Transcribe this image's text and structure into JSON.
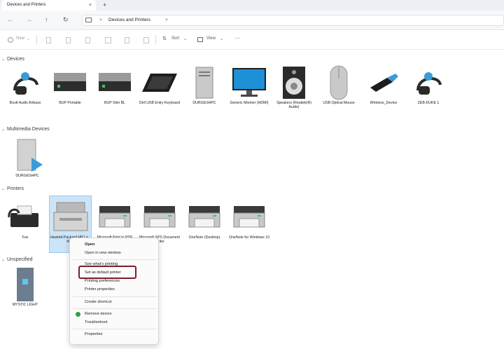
{
  "window": {
    "tab_title": "Devices and Printers",
    "close": "×",
    "new_tab": "+"
  },
  "address": {
    "back": "←",
    "forward": "→",
    "up": "↑",
    "refresh": "↻",
    "sep1": ">",
    "location": "Devices and Printers",
    "sep2": ">"
  },
  "toolbar": {
    "new": "New",
    "new_chev": "⌄",
    "sort": "Sort",
    "sort_chev": "⌄",
    "view": "View",
    "view_chev": "⌄",
    "more": "···"
  },
  "sections": {
    "devices": "Devices",
    "multimedia": "Multimedia Devices",
    "printers": "Printers",
    "unspecified": "Unspecified"
  },
  "devices": [
    {
      "label": "Boult Audio Airbass",
      "icon": "headset-icon"
    },
    {
      "label": "BUP Portable",
      "icon": "drive-icon"
    },
    {
      "label": "BUP Slim BL",
      "icon": "drive-icon"
    },
    {
      "label": "Dell USB Entry Keyboard",
      "icon": "keyboard-icon"
    },
    {
      "label": "DURGESHPC",
      "icon": "computer-icon"
    },
    {
      "label": "Generic Monitor (HDMI)",
      "icon": "monitor-icon"
    },
    {
      "label": "Speakers (Realtek(R) Audio)",
      "icon": "speaker-icon"
    },
    {
      "label": "USB Optical Mouse",
      "icon": "mouse-icon"
    },
    {
      "label": "Wireless_Device",
      "icon": "usb-dongle-icon"
    },
    {
      "label": "ZEB-DUKE 1",
      "icon": "headset-icon"
    }
  ],
  "multimedia": [
    {
      "label": "DURGESHPC",
      "icon": "media-server-icon"
    }
  ],
  "printers": [
    {
      "label": "Fax",
      "icon": "fax-icon"
    },
    {
      "label": "Hewlett-Packard HP La... MF...",
      "icon": "mfp-printer-icon"
    },
    {
      "label": "Microsoft Print to PDF",
      "icon": "printer-icon"
    },
    {
      "label": "Microsoft XPS Document Writer",
      "icon": "printer-icon"
    },
    {
      "label": "OneNote (Desktop)",
      "icon": "printer-icon"
    },
    {
      "label": "OneNote for Windows 10",
      "icon": "printer-icon"
    }
  ],
  "unspecified": [
    {
      "label": "MYSTIC LIGHT",
      "icon": "tower-icon"
    }
  ],
  "context_menu": {
    "open": "Open",
    "open_new_window": "Open in new window",
    "see_printing": "See what's printing",
    "set_default": "Set as default printer",
    "printing_prefs": "Printing preferences",
    "printer_props": "Printer properties",
    "create_shortcut": "Create shortcut",
    "remove_device": "Remove device",
    "troubleshoot": "Troubleshoot",
    "properties": "Properties"
  },
  "colors": {
    "selection": "#cce4f7",
    "highlight_box": "#7a1f2b",
    "accent": "#1a8cd8"
  }
}
